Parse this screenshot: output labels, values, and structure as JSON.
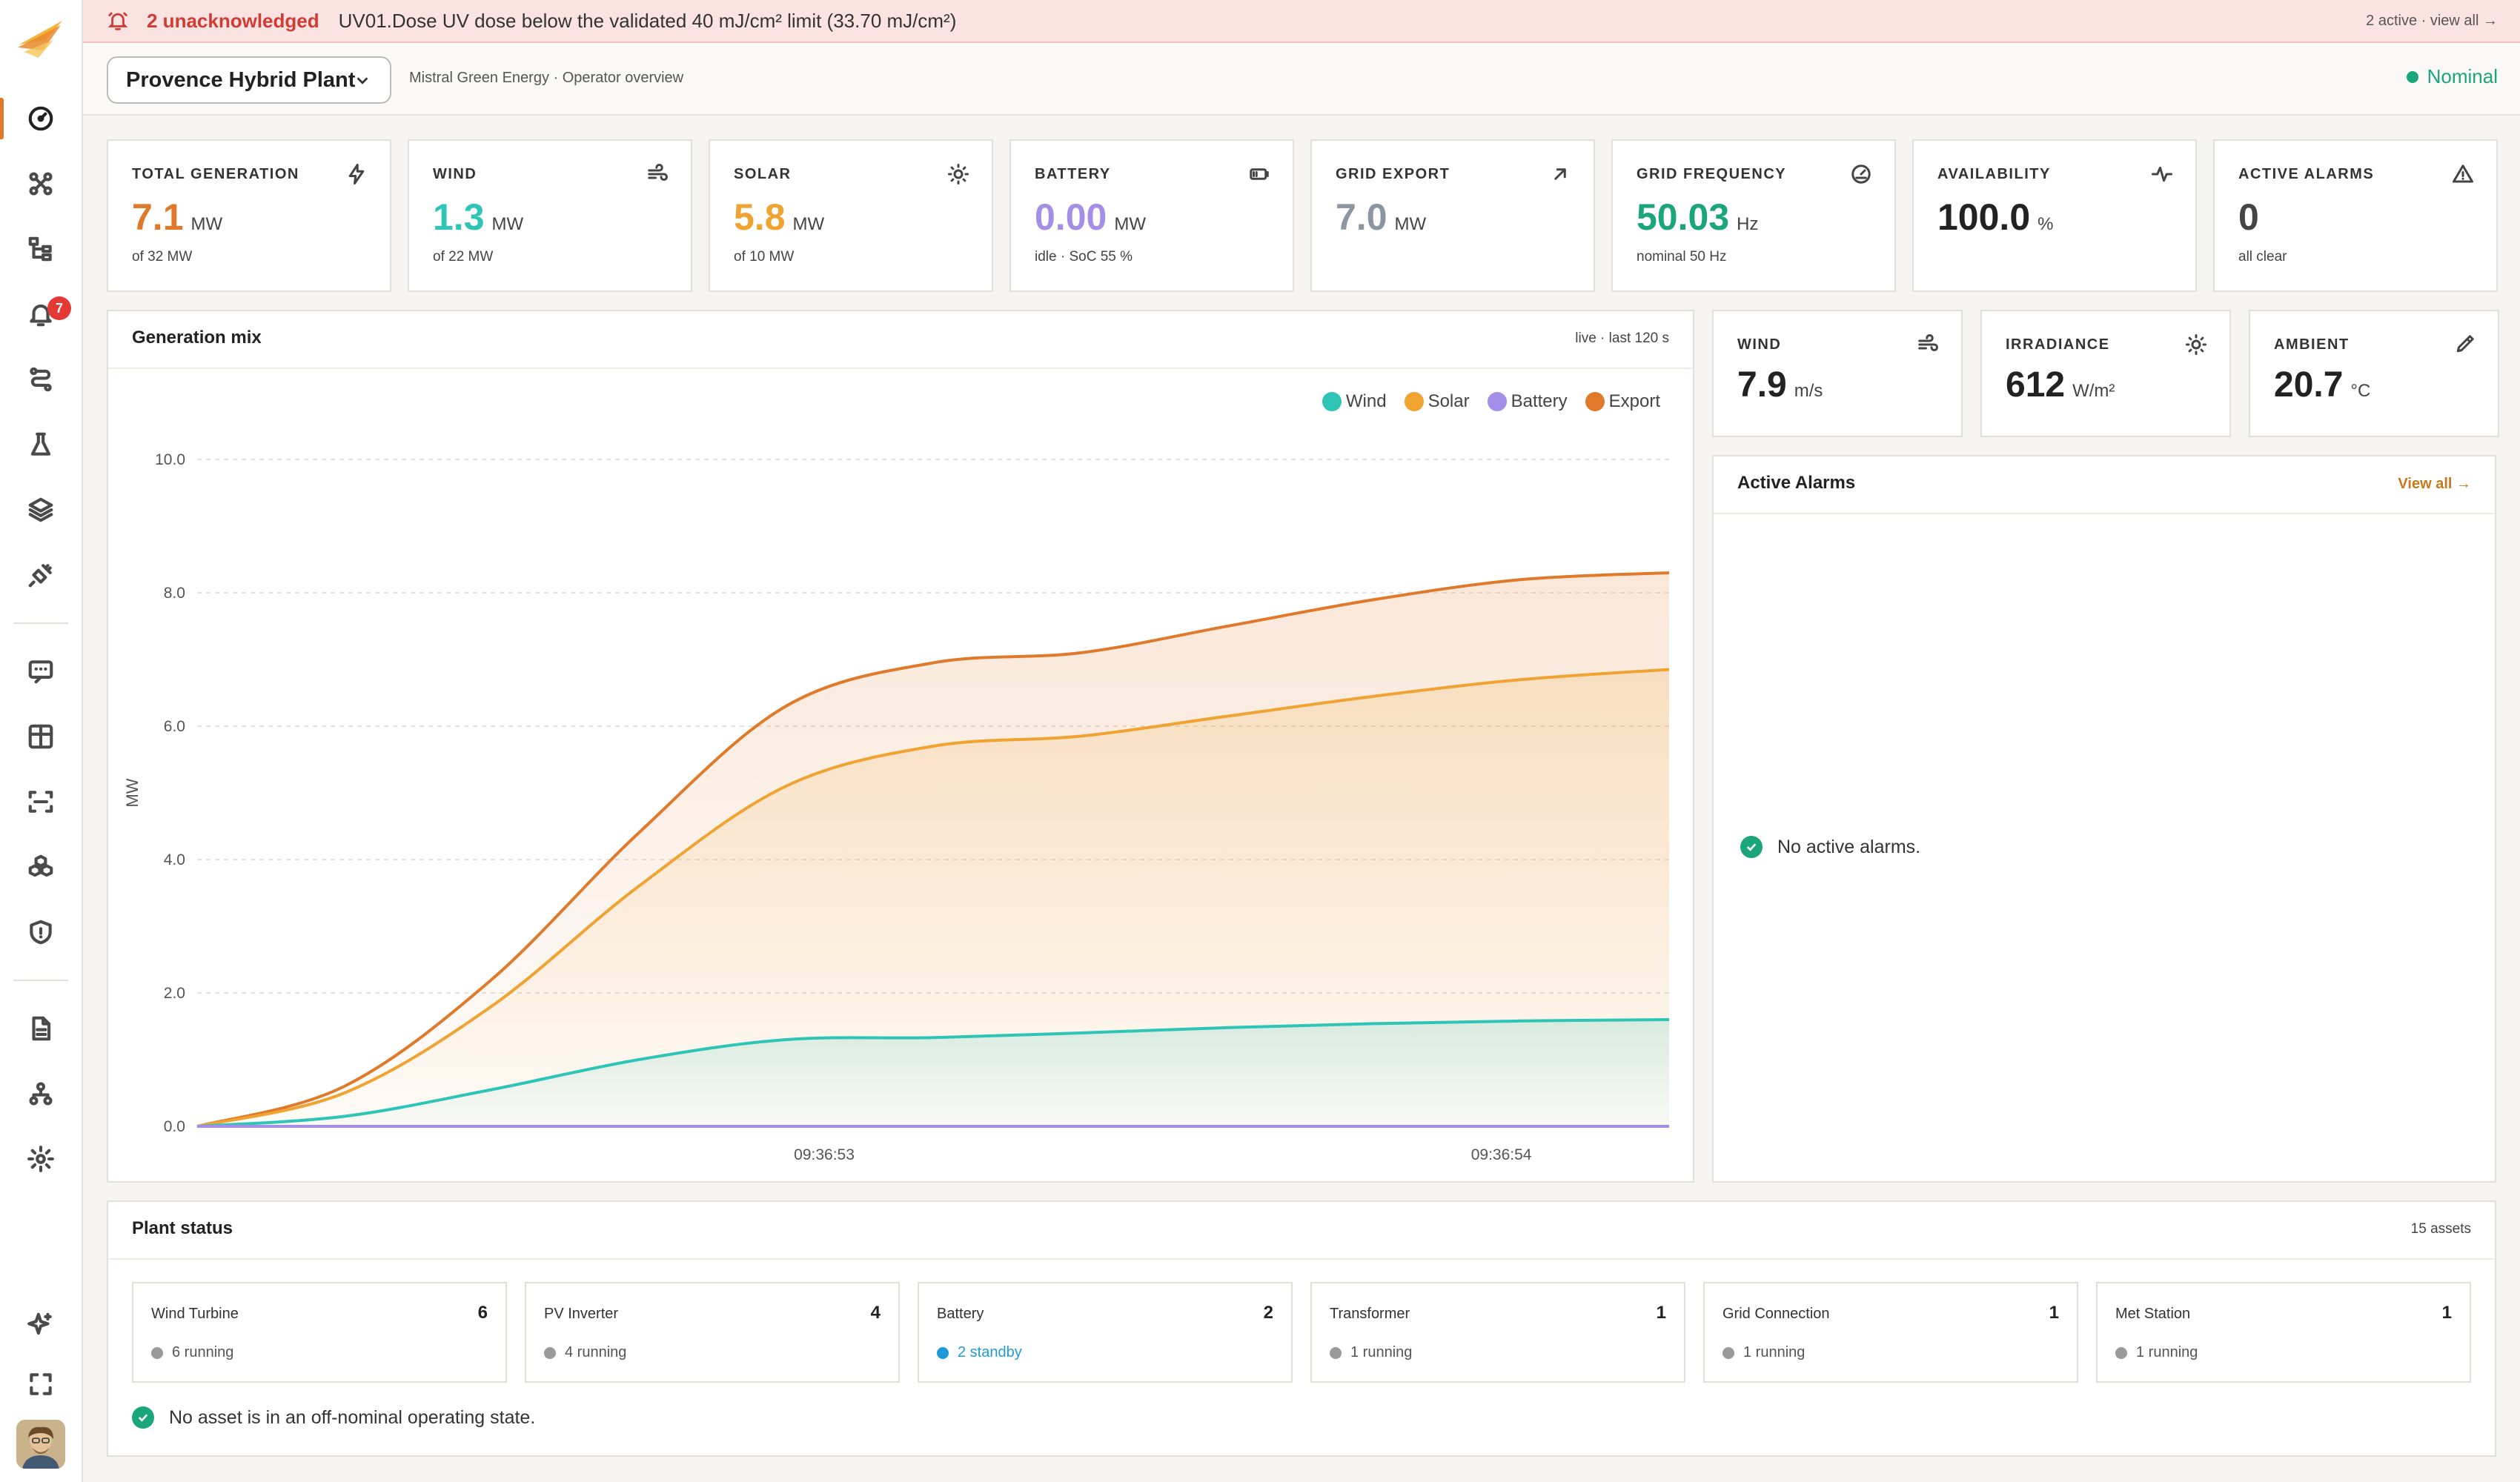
{
  "banner": {
    "count_label": "2 unacknowledged",
    "message": "UV01.Dose UV dose below the validated 40 mJ/cm² limit (33.70 mJ/cm²)",
    "right_link": "2 active · view all →"
  },
  "sidebar": {
    "badge": "7"
  },
  "header": {
    "plant_name": "Provence Hybrid Plant",
    "subtitle": "Mistral Green Energy · Operator overview",
    "status": "Nominal"
  },
  "kpis": [
    {
      "title": "TOTAL GENERATION",
      "value": "7.1",
      "unit": "MW",
      "sub": "of 32 MW",
      "color": "#e07a2a",
      "icon": "bolt-icon"
    },
    {
      "title": "WIND",
      "value": "1.3",
      "unit": "MW",
      "sub": "of 22 MW",
      "color": "#2ec4b6",
      "icon": "wind-icon"
    },
    {
      "title": "SOLAR",
      "value": "5.8",
      "unit": "MW",
      "sub": "of 10 MW",
      "color": "#f0a330",
      "icon": "sun-icon"
    },
    {
      "title": "BATTERY",
      "value": "0.00",
      "unit": "MW",
      "sub": "idle · SoC 55 %",
      "color": "#a58ee8",
      "icon": "battery-icon"
    },
    {
      "title": "GRID EXPORT",
      "value": "7.0",
      "unit": "MW",
      "sub": "",
      "color": "#8c96a3",
      "icon": "arrow-up-right-icon"
    },
    {
      "title": "GRID FREQUENCY",
      "value": "50.03",
      "unit": "Hz",
      "sub": "nominal 50 Hz",
      "color": "#1aa67a",
      "icon": "gauge-icon"
    },
    {
      "title": "AVAILABILITY",
      "value": "100.0",
      "unit": "%",
      "sub": "",
      "color": "#222222",
      "icon": "pulse-icon"
    },
    {
      "title": "ACTIVE ALARMS",
      "value": "0",
      "unit": "",
      "sub": "all clear",
      "color": "#444444",
      "icon": "warning-icon"
    }
  ],
  "generation_mix": {
    "title": "Generation mix",
    "note": "live · last 120 s"
  },
  "chart_data": {
    "type": "area",
    "ylabel": "MW",
    "ylim": [
      0,
      10
    ],
    "yticks": [
      "0.0",
      "2.0",
      "4.0",
      "6.0",
      "8.0",
      "10.0"
    ],
    "xtick_labels": [
      "09:36:53",
      "09:36:54"
    ],
    "legend_position": "top-right",
    "grid": true,
    "x": [
      0,
      0.1,
      0.2,
      0.3,
      0.4,
      0.5,
      0.6,
      0.7,
      0.8,
      0.9,
      1.0
    ],
    "series": [
      {
        "name": "Wind",
        "color": "#2ec4b6",
        "values": [
          0,
          0.15,
          0.55,
          1.0,
          1.3,
          1.33,
          1.4,
          1.48,
          1.54,
          1.58,
          1.6
        ]
      },
      {
        "name": "Solar",
        "color": "#f0a330",
        "values": [
          0,
          0.5,
          1.8,
          3.6,
          5.1,
          5.7,
          5.85,
          6.15,
          6.45,
          6.7,
          6.85
        ]
      },
      {
        "name": "Battery",
        "color": "#a58ee8",
        "values": [
          0,
          0,
          0,
          0,
          0,
          0,
          0,
          0,
          0,
          0,
          0
        ]
      },
      {
        "name": "Export",
        "color": "#e07a2a",
        "values": [
          0,
          0.6,
          2.2,
          4.4,
          6.3,
          6.95,
          7.1,
          7.5,
          7.9,
          8.2,
          8.3
        ]
      }
    ]
  },
  "weather": [
    {
      "title": "WIND",
      "value": "7.9",
      "unit": "m/s",
      "icon": "wind-icon"
    },
    {
      "title": "IRRADIANCE",
      "value": "612",
      "unit": "W/m²",
      "icon": "sun-icon"
    },
    {
      "title": "AMBIENT",
      "value": "20.7",
      "unit": "°C",
      "icon": "thermometer-icon"
    }
  ],
  "alarms": {
    "title": "Active Alarms",
    "link": "View all →",
    "empty": "No active alarms."
  },
  "plant_status": {
    "title": "Plant status",
    "count": "15 assets",
    "footer": "No asset is in an off-nominal operating state.",
    "assets": [
      {
        "name": "Wind Turbine",
        "count": "6",
        "state": "6 running",
        "state_color": "#9a9a9a",
        "text_color": "#555555"
      },
      {
        "name": "PV Inverter",
        "count": "4",
        "state": "4 running",
        "state_color": "#9a9a9a",
        "text_color": "#555555"
      },
      {
        "name": "Battery",
        "count": "2",
        "state": "2 standby",
        "state_color": "#1e9bd7",
        "text_color": "#1e9bd7"
      },
      {
        "name": "Transformer",
        "count": "1",
        "state": "1 running",
        "state_color": "#9a9a9a",
        "text_color": "#555555"
      },
      {
        "name": "Grid Connection",
        "count": "1",
        "state": "1 running",
        "state_color": "#9a9a9a",
        "text_color": "#555555"
      },
      {
        "name": "Met Station",
        "count": "1",
        "state": "1 running",
        "state_color": "#9a9a9a",
        "text_color": "#555555"
      }
    ]
  }
}
